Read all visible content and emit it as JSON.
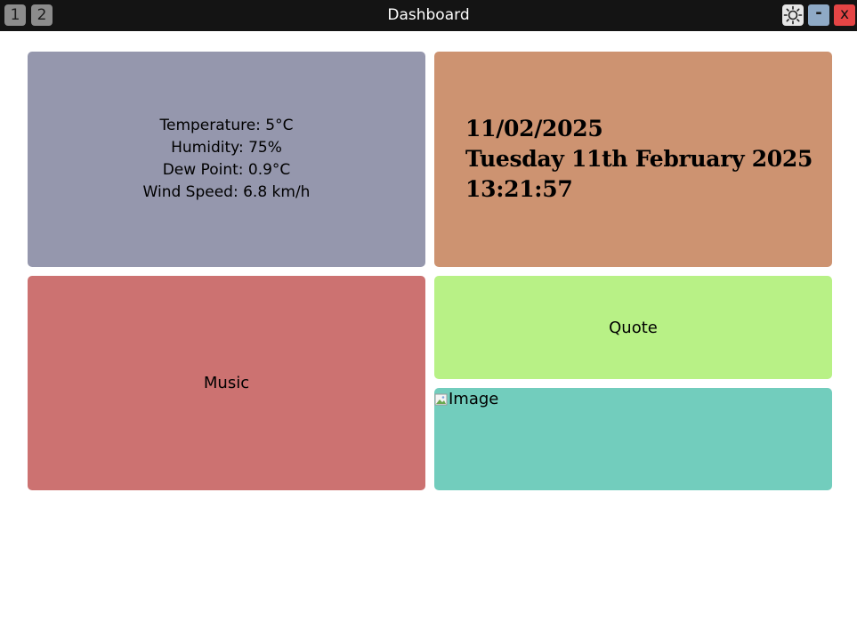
{
  "titlebar": {
    "workspace_buttons": [
      "1",
      "2"
    ],
    "title": "Dashboard",
    "theme_icon": "sun-icon",
    "minimize_label": "-",
    "close_label": "x"
  },
  "weather": {
    "lines": [
      "Temperature: 5°C",
      "Humidity: 75%",
      "Dew Point: 0.9°C",
      "Wind Speed: 6.8 km/h"
    ]
  },
  "datetime": {
    "date_short": "11/02/2025",
    "date_long": "Tuesday 11th February 2025",
    "time": "13:21:57"
  },
  "music": {
    "label": "Music"
  },
  "quote": {
    "label": "Quote"
  },
  "image": {
    "alt": "Image",
    "icon": "broken-image-icon"
  },
  "colors": {
    "titlebar_bg": "#141414",
    "weather_bg": "#9597ad",
    "datetime_bg": "#cd9371",
    "music_bg": "#cc7271",
    "quote_bg": "#b8f186",
    "image_bg": "#72cdbd",
    "minimize_bg": "#8faac6",
    "close_bg": "#e54545"
  }
}
